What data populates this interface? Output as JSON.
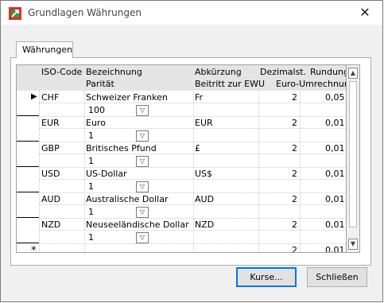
{
  "window": {
    "title": "Grundlagen Währungen",
    "close_glyph": "✕"
  },
  "tabs": [
    {
      "label": "Währungen"
    }
  ],
  "grid": {
    "header_row1": [
      "ISO-Code",
      "Bezeichnung",
      "Abkürzung",
      "Dezimalst.",
      "Rundung"
    ],
    "header_row2": [
      "Parität",
      "Beitritt zur EWU",
      "Euro-Umrechnung"
    ],
    "rows": [
      {
        "iso": "CHF",
        "name": "Schweizer Franken",
        "abbr": "Fr",
        "decimals": "2",
        "rounding": "0,05",
        "parity": "100",
        "current": true
      },
      {
        "iso": "EUR",
        "name": "Euro",
        "abbr": "EUR",
        "decimals": "2",
        "rounding": "0,01",
        "parity": "1"
      },
      {
        "iso": "GBP",
        "name": "Britisches Pfund",
        "abbr": "£",
        "decimals": "2",
        "rounding": "0,01",
        "parity": "1"
      },
      {
        "iso": "USD",
        "name": "US-Dollar",
        "abbr": "US$",
        "decimals": "2",
        "rounding": "0,01",
        "parity": "1"
      },
      {
        "iso": "AUD",
        "name": "Australische Dollar",
        "abbr": "AUD",
        "decimals": "2",
        "rounding": "0,01",
        "parity": "1"
      },
      {
        "iso": "NZD",
        "name": "Neuseeländische Dollar",
        "abbr": "NZD",
        "decimals": "2",
        "rounding": "0,01",
        "parity": "1"
      }
    ],
    "new_row": {
      "marker": "*",
      "decimals": "2",
      "rounding": "0,01"
    },
    "current_row_marker": "▶"
  },
  "buttons": {
    "kurse": "Kurse...",
    "schliessen": "Schließen"
  },
  "icons": {
    "app": "currency-app-icon",
    "dropdown": "chevron-down-icon"
  }
}
